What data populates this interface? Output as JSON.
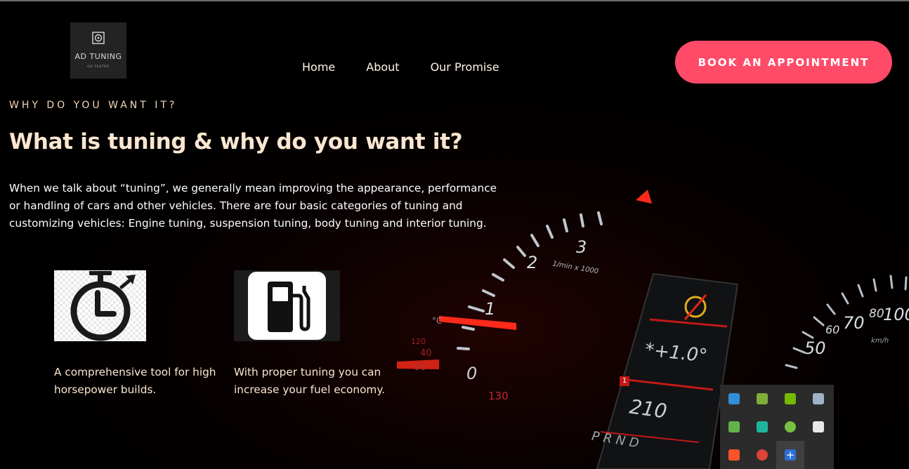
{
  "logo": {
    "name": "AD TUNING",
    "tagline": "GO FASTER"
  },
  "nav": {
    "items": [
      "Home",
      "About",
      "Our Promise"
    ]
  },
  "cta": {
    "label": "BOOK AN APPOINTMENT",
    "color": "#ff4a68"
  },
  "section": {
    "eyebrow": "WHY DO YOU WANT IT?",
    "title": "What is tuning & why do you want it?",
    "intro": "When we talk about “tuning”, we generally mean improving the appearance, performance or handling of cars and other vehicles. There are four basic categories of tuning and customizing vehicles: Engine tuning, suspension tuning, body tuning and interior tuning."
  },
  "features": [
    {
      "icon": "stopwatch-icon",
      "text": "A comprehensive tool for high horsepower builds."
    },
    {
      "icon": "fuel-pump-icon",
      "text": "With proper tuning you can increase your fuel economy."
    }
  ],
  "background": {
    "gauge_numbers": [
      "1",
      "2",
      "3",
      "1/min x 1000",
      "0",
      "40",
      "90",
      "120",
      "130",
      "°C",
      "50",
      "60",
      "70",
      "80",
      "100",
      "km/h"
    ],
    "display": {
      "temperature": "*+1.0°",
      "range": "210",
      "gear": "P R N D",
      "warning_count": "1"
    }
  },
  "tray": {
    "icons": [
      "network-icon",
      "notepad-icon",
      "nvidia-icon",
      "laptop-icon",
      "gpu-icon",
      "cast-icon",
      "utorrent-icon",
      "security-shield-icon",
      "brave-icon",
      "chrome-icon",
      "add-icon"
    ],
    "colors": [
      "#2f8fd8",
      "#7fae3a",
      "#76b900",
      "#9fb3c8",
      "#63b34a",
      "#1fb59b",
      "#78c043",
      "#e8e8e8",
      "#fb542b",
      "#db4437",
      "#2a6fd6"
    ]
  }
}
